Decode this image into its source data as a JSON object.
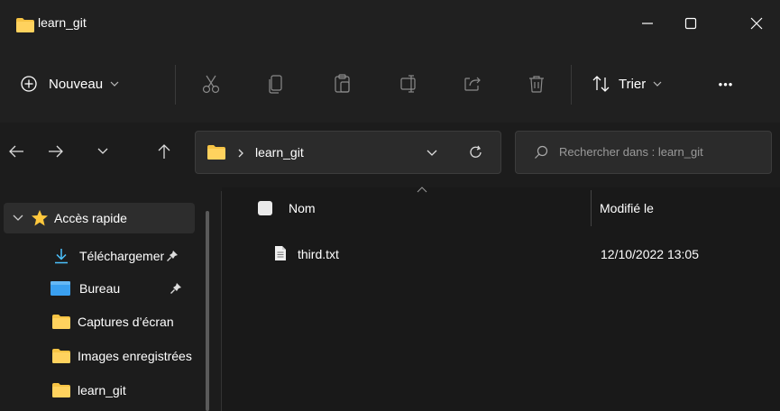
{
  "window": {
    "title": "learn_git"
  },
  "toolbar": {
    "new_label": "Nouveau",
    "sort_label": "Trier",
    "more_label": "•••",
    "icons": [
      "cut-icon",
      "copy-icon",
      "paste-icon",
      "rename-icon",
      "share-icon",
      "delete-icon"
    ]
  },
  "address": {
    "path": "learn_git"
  },
  "search": {
    "placeholder": "Rechercher dans : learn_git"
  },
  "sidebar": {
    "items": [
      {
        "label": "Accès rapide"
      },
      {
        "label": "Téléchargements"
      },
      {
        "label": "Bureau"
      },
      {
        "label": "Captures d’écran"
      },
      {
        "label": "Images enregistrées"
      },
      {
        "label": "learn_git"
      }
    ]
  },
  "columns": {
    "name": "Nom",
    "modified": "Modifié le"
  },
  "files": [
    {
      "name": "third.txt",
      "modified": "12/10/2022 13:05"
    }
  ],
  "colors": {
    "folder": "#f6c344",
    "accent": "#ffc83d",
    "download": "#4cc2ff",
    "desktop": "#3aa0f0"
  }
}
